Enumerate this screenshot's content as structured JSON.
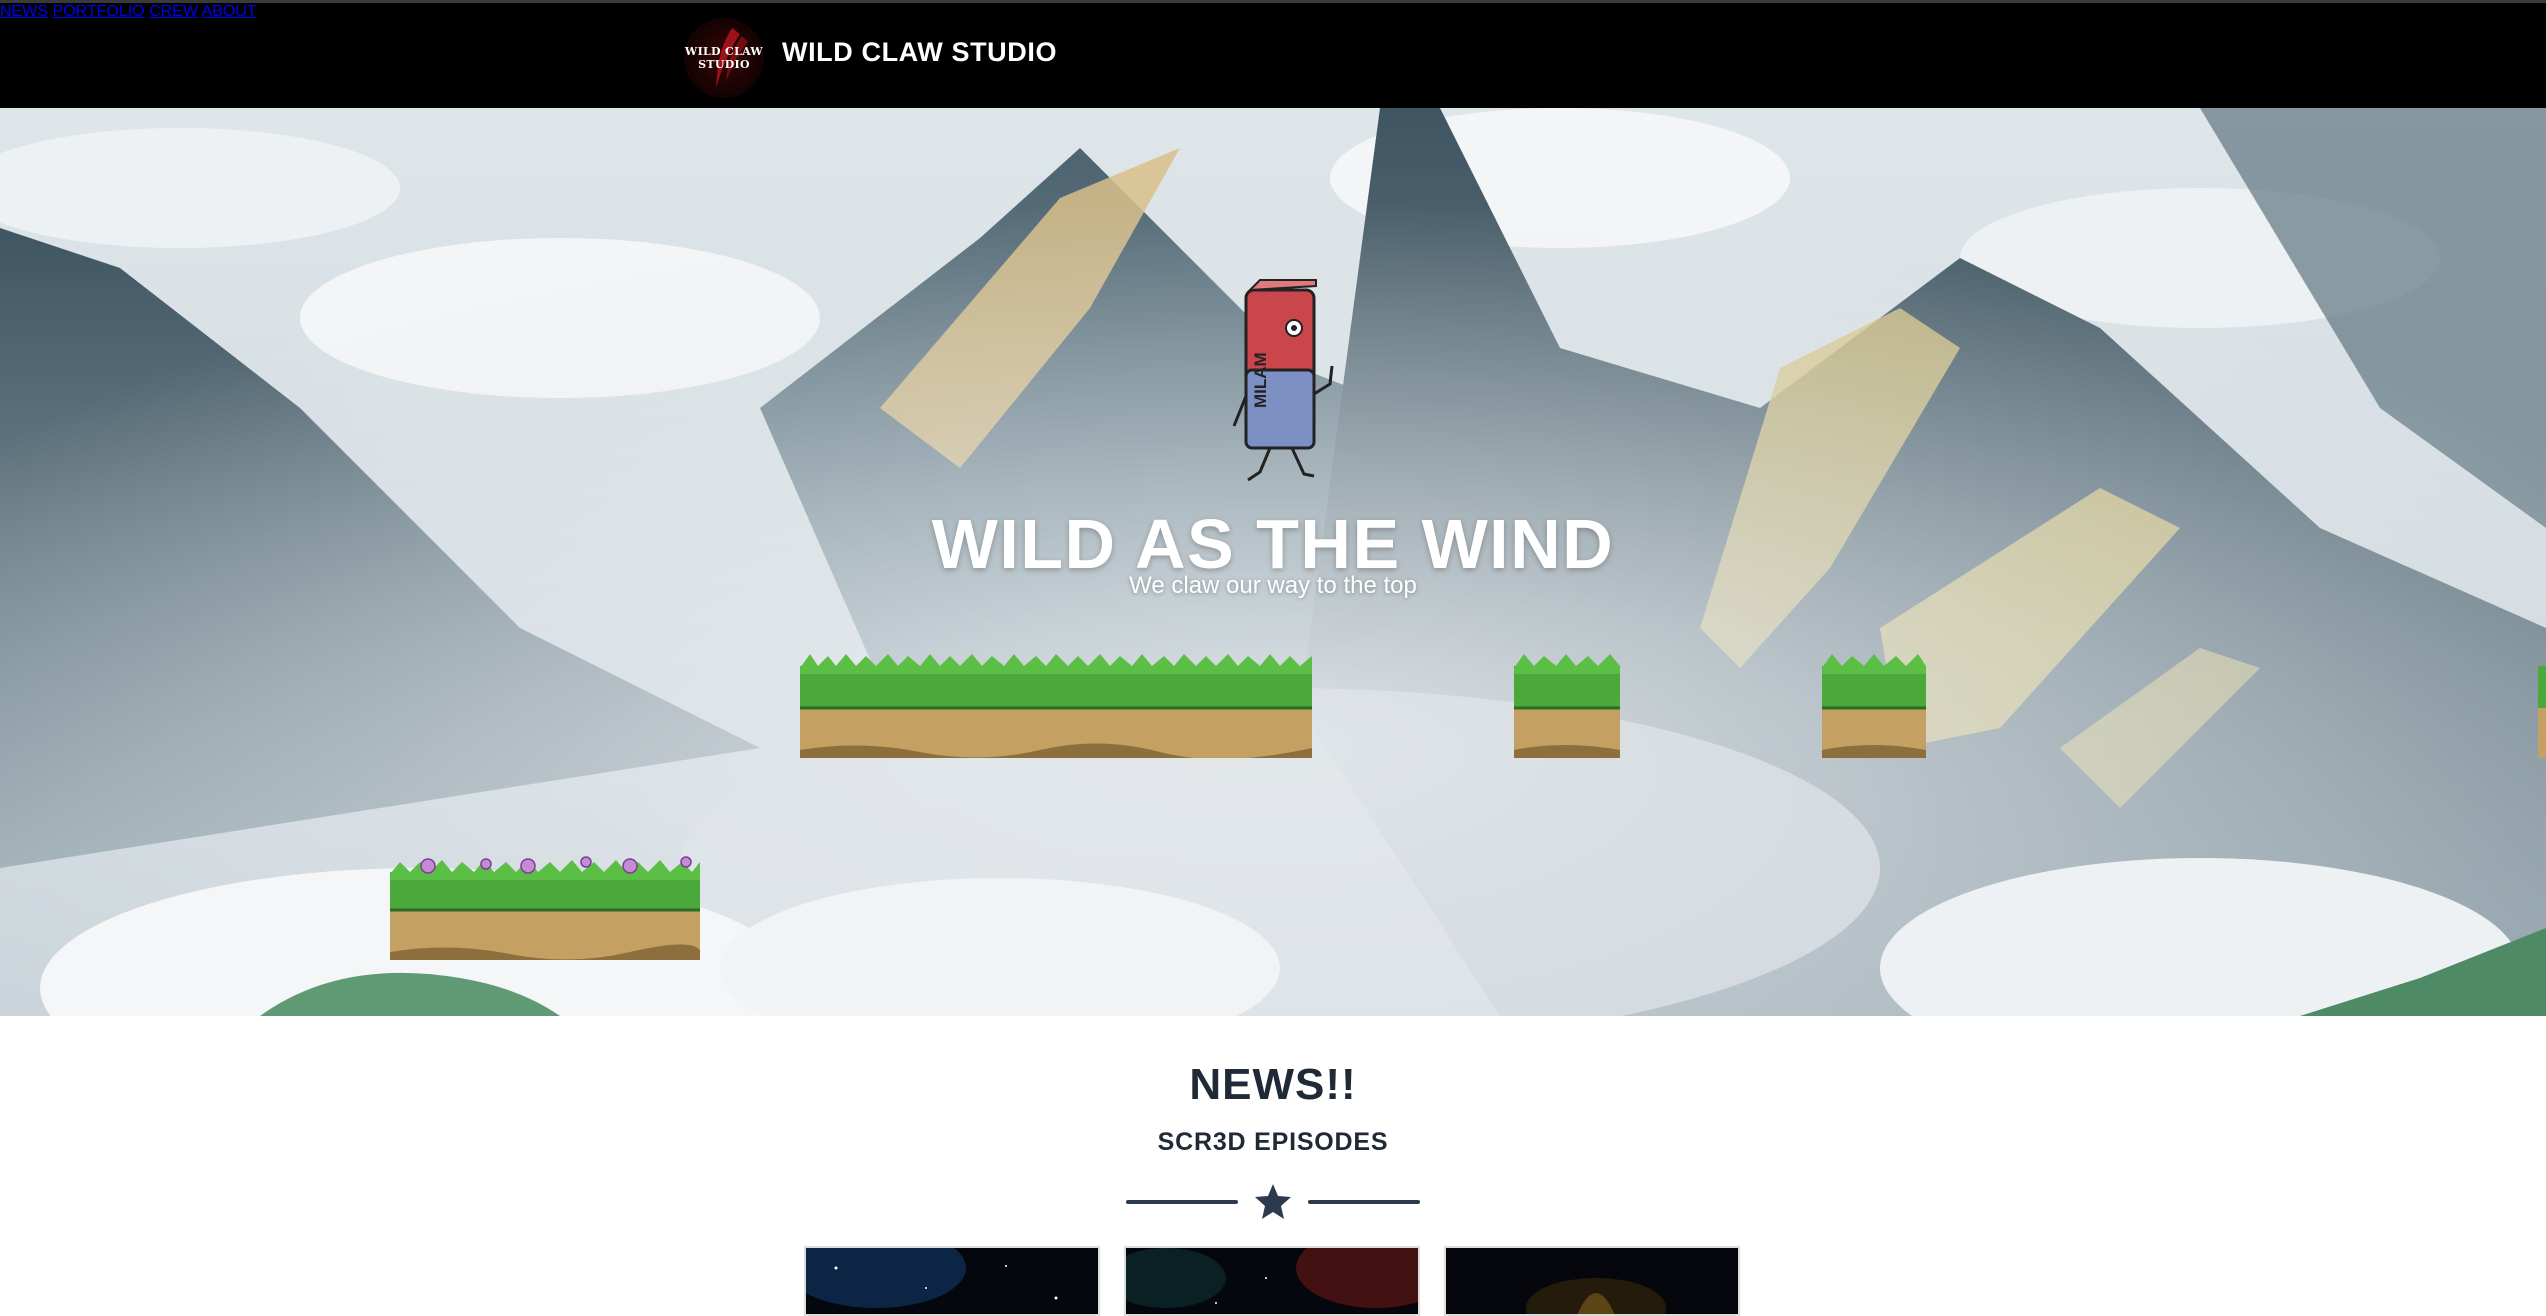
{
  "header": {
    "logo_text_line1": "WILD CLAW",
    "logo_text_line2": "STUDIO",
    "brand": "WILD CLAW STUDIO",
    "nav": [
      {
        "label": "NEWS"
      },
      {
        "label": "PORTFOLIO"
      },
      {
        "label": "CREW"
      },
      {
        "label": "ABOUT"
      }
    ]
  },
  "hero": {
    "title": "WILD AS THE WIND",
    "subtitle": "We claw our way to the top",
    "character_label": "MILAM"
  },
  "news": {
    "title": "NEWS!!",
    "subtitle": "SCR3D EPISODES"
  },
  "colors": {
    "navbar_bg": "#000000",
    "heading": "#1f2a36",
    "accent": "#2b3a4c",
    "grass": "#4aa93a",
    "dirt": "#c4a163"
  }
}
